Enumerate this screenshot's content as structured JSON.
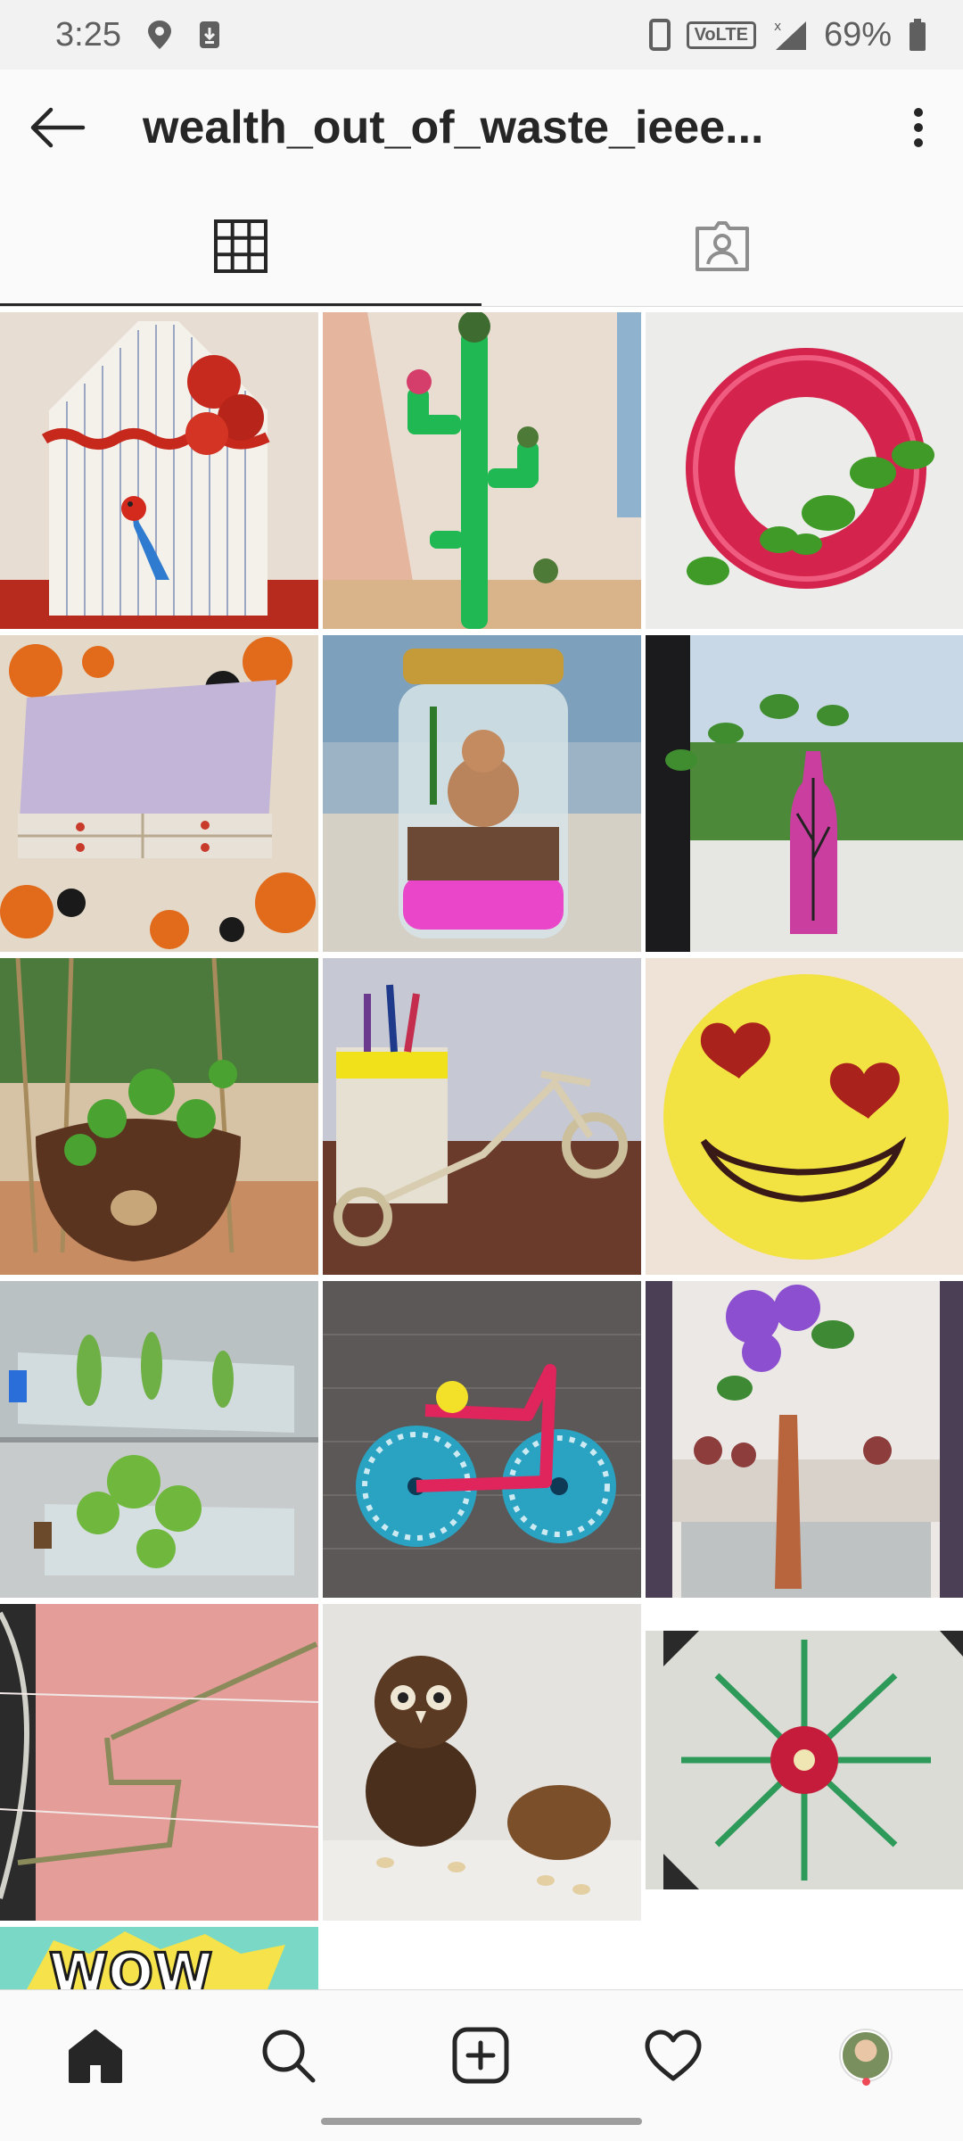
{
  "status_bar": {
    "time": "3:25",
    "network_badge": "VoLTE",
    "battery": "69%",
    "icons": [
      "location-icon",
      "download-icon",
      "phone-icon",
      "signal-icon",
      "battery-icon"
    ]
  },
  "header": {
    "title": "wealth_out_of_waste_ieee...",
    "back_icon": "arrow-left-icon",
    "more_icon": "more-vertical-icon"
  },
  "tabs": [
    {
      "name": "grid",
      "icon": "grid-icon",
      "active": true
    },
    {
      "name": "tagged",
      "icon": "tagged-person-icon",
      "active": false
    }
  ],
  "grid": {
    "columns": 3,
    "posts": [
      {
        "subject": "book folding art with red paper roses and parrot"
      },
      {
        "subject": "green pipe cactus planter"
      },
      {
        "subject": "pink tyre planter with money plant"
      },
      {
        "subject": "matchbox drawer organizer"
      },
      {
        "subject": "jar terrarium with Ganesha figure"
      },
      {
        "subject": "painted bottle with money plant by window"
      },
      {
        "subject": "hanging coconut shell succulent planter"
      },
      {
        "subject": "newspaper roll bicycle pen holder"
      },
      {
        "subject": "yellow yarn heart-eyes emoji"
      },
      {
        "subject": "plastic bottle planters"
      },
      {
        "subject": "bicycle craft with blue paper wheels"
      },
      {
        "subject": "decorated bottle vase with flowers"
      },
      {
        "subject": "wire art on pink wall"
      },
      {
        "subject": "coconut shell owl"
      },
      {
        "subject": "plastic bottle flower wall decor"
      },
      {
        "subject": "wow comic text"
      }
    ],
    "last_post_text": "WOW"
  },
  "bottom_nav": [
    {
      "name": "home",
      "icon": "home-icon",
      "active": true
    },
    {
      "name": "search",
      "icon": "search-icon"
    },
    {
      "name": "new-post",
      "icon": "add-post-icon"
    },
    {
      "name": "activity",
      "icon": "heart-icon"
    },
    {
      "name": "profile",
      "icon": "profile-avatar"
    }
  ],
  "colors": {
    "background": "#ffffff",
    "bar": "#fafafa",
    "text": "#262626",
    "notification": "#ed4956"
  }
}
